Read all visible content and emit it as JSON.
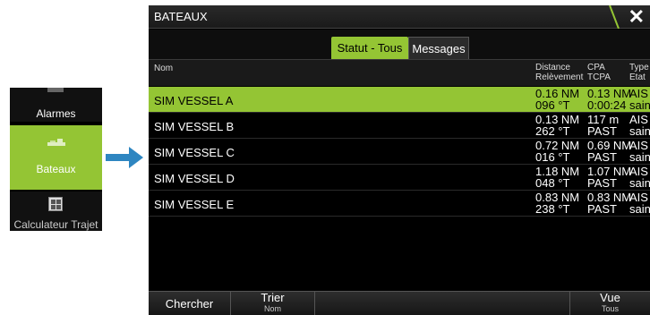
{
  "sidebar": {
    "alarms_label": "Alarmes",
    "vessels_label": "Bateaux",
    "calc_label": "Calculateur Trajet"
  },
  "dialog": {
    "title": "BATEAUX",
    "close_glyph": "✕",
    "tabs": [
      {
        "label": "Statut - Tous",
        "active": true
      },
      {
        "label": "Messages",
        "active": false
      }
    ],
    "columns": {
      "name": "Nom",
      "dist_top": "Distance",
      "dist_bottom": "Relèvement",
      "cpa_top": "CPA",
      "cpa_bottom": "TCPA",
      "type_top": "Type",
      "type_bottom": "Etat"
    },
    "rows": [
      {
        "name": "SIM VESSEL A",
        "dist": "0.16 NM",
        "brg": "096 °T",
        "cpa": "0.13 NM",
        "tcpa": "0:00:24",
        "type": "AIS",
        "state": "sain"
      },
      {
        "name": "SIM VESSEL B",
        "dist": "0.13 NM",
        "brg": "262 °T",
        "cpa": "117 m",
        "tcpa": "PAST",
        "type": "AIS",
        "state": "sain"
      },
      {
        "name": "SIM VESSEL C",
        "dist": "0.72 NM",
        "brg": "016 °T",
        "cpa": "0.69 NM",
        "tcpa": "PAST",
        "type": "AIS",
        "state": "sain"
      },
      {
        "name": "SIM VESSEL D",
        "dist": "1.18 NM",
        "brg": "048 °T",
        "cpa": "1.07 NM",
        "tcpa": "PAST",
        "type": "AIS",
        "state": "sain"
      },
      {
        "name": "SIM VESSEL E",
        "dist": "0.83 NM",
        "brg": "238 °T",
        "cpa": "0.83 NM",
        "tcpa": "PAST",
        "type": "AIS",
        "state": "sain"
      }
    ],
    "footer": {
      "search": "Chercher",
      "sort": "Trier",
      "sort_sub": "Nom",
      "view": "Vue",
      "view_sub": "Tous"
    }
  },
  "colors": {
    "accent": "#94c534",
    "arrow": "#2e86c1"
  }
}
